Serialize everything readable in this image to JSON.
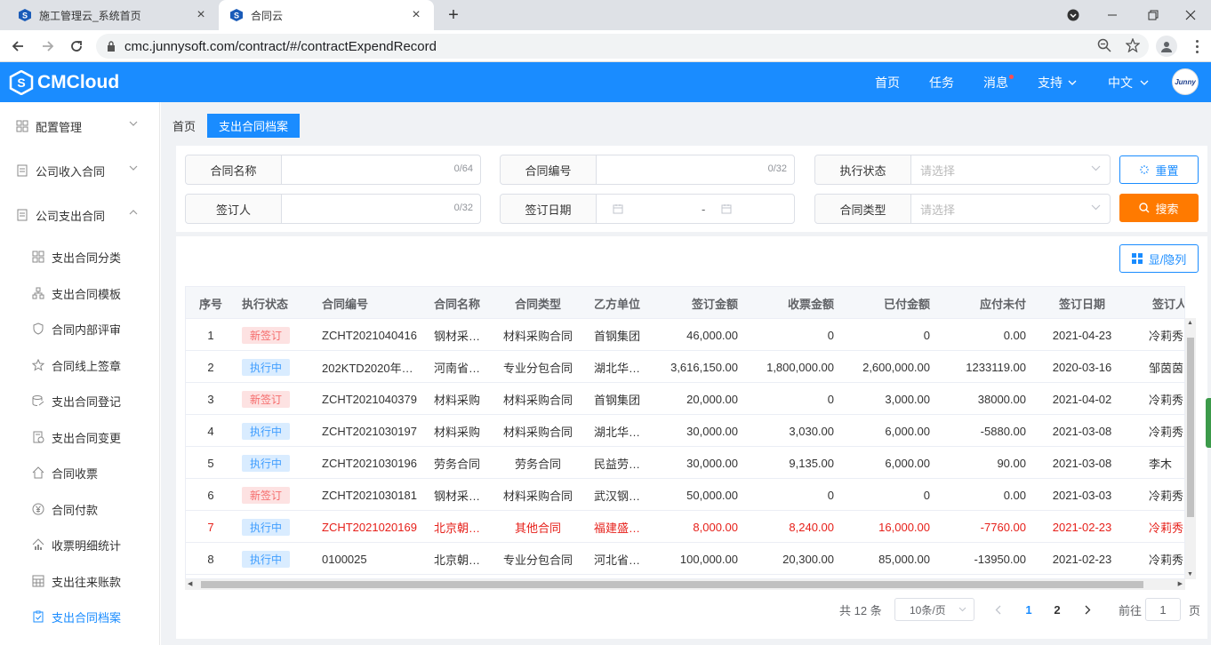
{
  "browser": {
    "tabs": [
      {
        "title": "施工管理云_系统首页"
      },
      {
        "title": "合同云"
      }
    ],
    "url": "cmc.junnysoft.com/contract/#/contractExpendRecord"
  },
  "app": {
    "logo": "CMCloud",
    "nav": [
      {
        "label": "首页"
      },
      {
        "label": "任务"
      },
      {
        "label": "消息"
      },
      {
        "label": "支持"
      },
      {
        "label": "中文"
      }
    ],
    "avatar_text": "Junny"
  },
  "sidebar": {
    "groups": [
      {
        "label": "配置管理",
        "icon": "grid-icon"
      },
      {
        "label": "公司收入合同",
        "icon": "doc-icon"
      },
      {
        "label": "公司支出合同",
        "icon": "doc-icon"
      }
    ],
    "items": [
      {
        "label": "支出合同分类",
        "icon": "grid-icon"
      },
      {
        "label": "支出合同模板",
        "icon": "tree-icon"
      },
      {
        "label": "合同内部评审",
        "icon": "shield-icon"
      },
      {
        "label": "合同线上签章",
        "icon": "star-icon"
      },
      {
        "label": "支出合同登记",
        "icon": "register-icon"
      },
      {
        "label": "支出合同变更",
        "icon": "change-icon"
      },
      {
        "label": "合同收票",
        "icon": "home-icon"
      },
      {
        "label": "合同付款",
        "icon": "yen-icon"
      },
      {
        "label": "收票明细统计",
        "icon": "stats-icon"
      },
      {
        "label": "支出往来账款",
        "icon": "calc-icon"
      },
      {
        "label": "支出合同档案",
        "icon": "clipboard-icon",
        "active": true
      }
    ]
  },
  "breadcrumb": [
    {
      "label": "首页"
    },
    {
      "label": "支出合同档案"
    }
  ],
  "filters": {
    "contract_name": {
      "label": "合同名称",
      "count": "0/64"
    },
    "contract_no": {
      "label": "合同编号",
      "count": "0/32"
    },
    "exec_status": {
      "label": "执行状态",
      "placeholder": "请选择"
    },
    "signer": {
      "label": "签订人",
      "count": "0/32"
    },
    "sign_date": {
      "label": "签订日期",
      "sep": "-"
    },
    "contract_type": {
      "label": "合同类型",
      "placeholder": "请选择"
    },
    "reset_label": "重置",
    "search_label": "搜索"
  },
  "toolbar": {
    "columns_label": "显/隐列"
  },
  "table": {
    "headers": [
      "序号",
      "执行状态",
      "合同编号",
      "合同名称",
      "合同类型",
      "乙方单位",
      "签订金额",
      "收票金额",
      "已付金额",
      "应付未付",
      "签订日期",
      "签订人"
    ],
    "rows": [
      {
        "no": "1",
        "status": "新签订",
        "status_type": "new",
        "code": "ZCHT2021040416",
        "name": "钢材采…",
        "type": "材料采购合同",
        "party": "首钢集团",
        "sign_amt": "46,000.00",
        "invoice_amt": "0",
        "paid_amt": "0",
        "unpaid": "0.00",
        "date": "2021-04-23",
        "signer": "冷莉秀",
        "red": false
      },
      {
        "no": "2",
        "status": "执行中",
        "status_type": "exec",
        "code": "202KTD2020年…",
        "name": "河南省…",
        "type": "专业分包合同",
        "party": "湖北华…",
        "sign_amt": "3,616,150.00",
        "invoice_amt": "1,800,000.00",
        "paid_amt": "2,600,000.00",
        "unpaid": "1233119.00",
        "date": "2020-03-16",
        "signer": "邹茵茵",
        "red": false
      },
      {
        "no": "3",
        "status": "新签订",
        "status_type": "new",
        "code": "ZCHT2021040379",
        "name": "材料采购",
        "type": "材料采购合同",
        "party": "首钢集团",
        "sign_amt": "20,000.00",
        "invoice_amt": "0",
        "paid_amt": "3,000.00",
        "unpaid": "38000.00",
        "date": "2021-04-02",
        "signer": "冷莉秀",
        "red": false
      },
      {
        "no": "4",
        "status": "执行中",
        "status_type": "exec",
        "code": "ZCHT2021030197",
        "name": "材料采购",
        "type": "材料采购合同",
        "party": "湖北华…",
        "sign_amt": "30,000.00",
        "invoice_amt": "3,030.00",
        "paid_amt": "6,000.00",
        "unpaid": "-5880.00",
        "date": "2021-03-08",
        "signer": "冷莉秀",
        "red": false
      },
      {
        "no": "5",
        "status": "执行中",
        "status_type": "exec",
        "code": "ZCHT2021030196",
        "name": "劳务合同",
        "type": "劳务合同",
        "party": "民益劳…",
        "sign_amt": "30,000.00",
        "invoice_amt": "9,135.00",
        "paid_amt": "6,000.00",
        "unpaid": "90.00",
        "date": "2021-03-08",
        "signer": "李木",
        "red": false
      },
      {
        "no": "6",
        "status": "新签订",
        "status_type": "new",
        "code": "ZCHT2021030181",
        "name": "钢材采…",
        "type": "材料采购合同",
        "party": "武汉钢…",
        "sign_amt": "50,000.00",
        "invoice_amt": "0",
        "paid_amt": "0",
        "unpaid": "0.00",
        "date": "2021-03-03",
        "signer": "冷莉秀",
        "red": false
      },
      {
        "no": "7",
        "status": "执行中",
        "status_type": "exec",
        "code": "ZCHT2021020169",
        "name": "北京朝…",
        "type": "其他合同",
        "party": "福建盛…",
        "sign_amt": "8,000.00",
        "invoice_amt": "8,240.00",
        "paid_amt": "16,000.00",
        "unpaid": "-7760.00",
        "date": "2021-02-23",
        "signer": "冷莉秀",
        "red": true
      },
      {
        "no": "8",
        "status": "执行中",
        "status_type": "exec",
        "code": "0100025",
        "name": "北京朝…",
        "type": "专业分包合同",
        "party": "河北省…",
        "sign_amt": "100,000.00",
        "invoice_amt": "20,300.00",
        "paid_amt": "85,000.00",
        "unpaid": "-13950.00",
        "date": "2021-02-23",
        "signer": "冷莉秀",
        "red": false
      }
    ]
  },
  "pagination": {
    "total": "共 12 条",
    "page_size": "10条/页",
    "pages": [
      "1",
      "2"
    ],
    "current_page": "1",
    "goto_prefix": "前往",
    "goto_value": "1",
    "goto_suffix": "页"
  }
}
